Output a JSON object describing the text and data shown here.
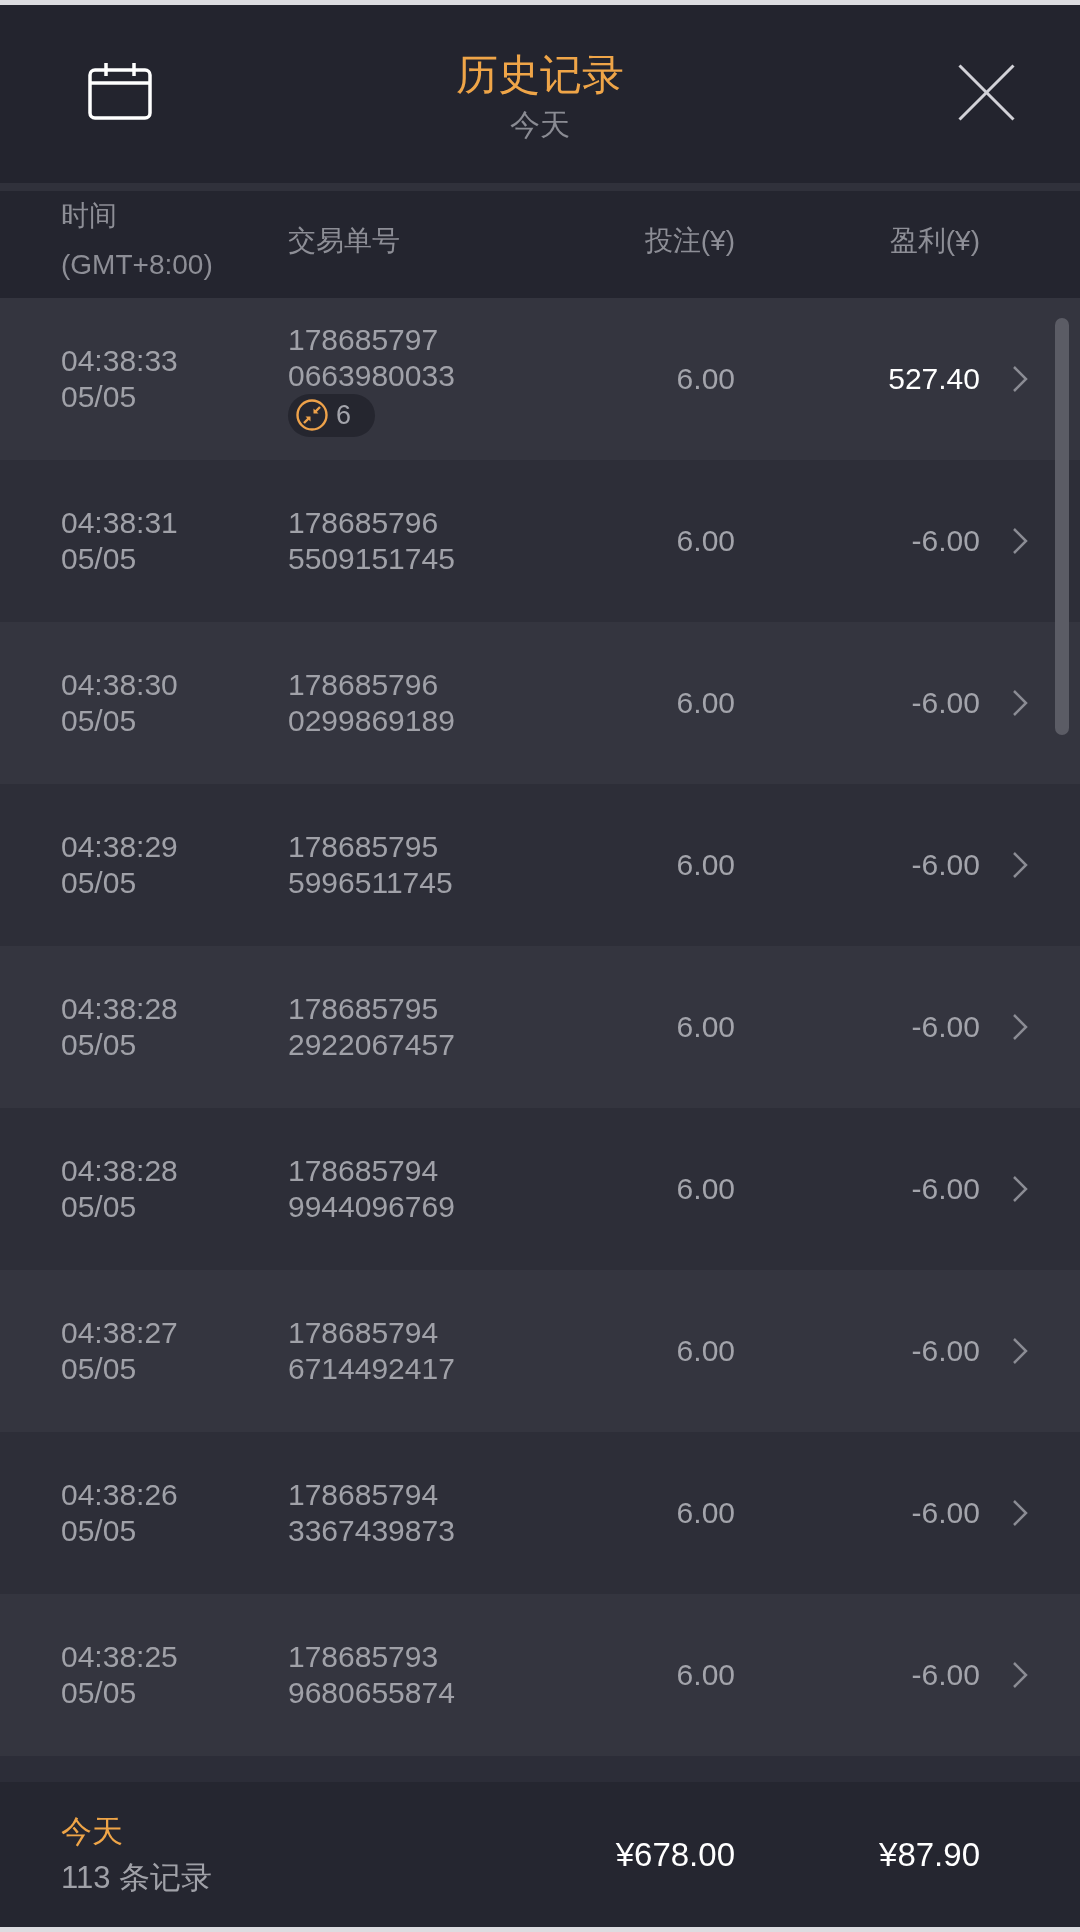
{
  "header": {
    "title": "历史记录",
    "subtitle": "今天"
  },
  "columns": [
    {
      "label": "时间",
      "sublabel": "(GMT+8:00)"
    },
    {
      "label": "交易单号"
    },
    {
      "label": "投注(¥)"
    },
    {
      "label": "盈利(¥)"
    }
  ],
  "rows": [
    {
      "time": "04:38:33",
      "date": "05/05",
      "order_no": [
        "178685797",
        "0663980033"
      ],
      "badge": {
        "count": "6"
      },
      "bet": "6.00",
      "profit": "527.40",
      "win": true
    },
    {
      "time": "04:38:31",
      "date": "05/05",
      "order_no": [
        "178685796",
        "5509151745"
      ],
      "bet": "6.00",
      "profit": "-6.00",
      "win": false
    },
    {
      "time": "04:38:30",
      "date": "05/05",
      "order_no": [
        "178685796",
        "0299869189"
      ],
      "bet": "6.00",
      "profit": "-6.00",
      "win": false
    },
    {
      "time": "04:38:29",
      "date": "05/05",
      "order_no": [
        "178685795",
        "5996511745"
      ],
      "bet": "6.00",
      "profit": "-6.00",
      "win": false
    },
    {
      "time": "04:38:28",
      "date": "05/05",
      "order_no": [
        "178685795",
        "2922067457"
      ],
      "bet": "6.00",
      "profit": "-6.00",
      "win": false
    },
    {
      "time": "04:38:28",
      "date": "05/05",
      "order_no": [
        "178685794",
        "9944096769"
      ],
      "bet": "6.00",
      "profit": "-6.00",
      "win": false
    },
    {
      "time": "04:38:27",
      "date": "05/05",
      "order_no": [
        "178685794",
        "6714492417"
      ],
      "bet": "6.00",
      "profit": "-6.00",
      "win": false
    },
    {
      "time": "04:38:26",
      "date": "05/05",
      "order_no": [
        "178685794",
        "3367439873"
      ],
      "bet": "6.00",
      "profit": "-6.00",
      "win": false
    },
    {
      "time": "04:38:25",
      "date": "05/05",
      "order_no": [
        "178685793",
        "9680655874"
      ],
      "bet": "6.00",
      "profit": "-6.00",
      "win": false
    }
  ],
  "summary": {
    "period": "今天",
    "record_count": "113 条记录",
    "total_bet": "¥678.00",
    "total_profit": "¥87.90"
  }
}
